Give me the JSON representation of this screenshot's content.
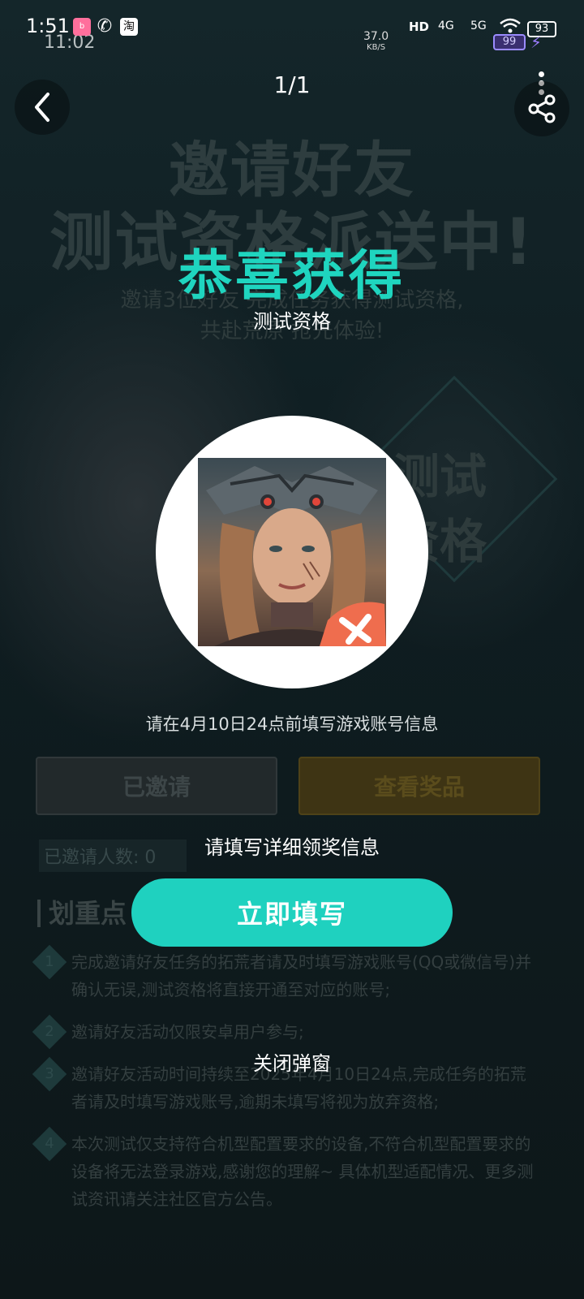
{
  "status_bar": {
    "time": "1:51",
    "time_secondary": "11:02",
    "speed_value": "37.0",
    "speed_unit": "KB/S",
    "hd": "HD",
    "net1": "4G",
    "net2": "5G",
    "battery": "93",
    "battery_secondary": "99"
  },
  "nav": {
    "page_indicator": "1/1"
  },
  "background": {
    "headline_line1": "邀请好友",
    "headline_line2": "测试资格派送中!",
    "sub_line1": "邀请3位好友 完成任务获得测试资格,",
    "sub_line2": "共赴荒原 抢先体验!",
    "badge_line1": "测试",
    "badge_line2": "资格",
    "invited_button": "已邀请",
    "prize_button": "查看奖品",
    "invited_count": "已邀请人数: 0",
    "section_title": "划重点",
    "rules": [
      "完成邀请好友任务的拓荒者请及时填写游戏账号(QQ或微信号)并确认无误,测试资格将直接开通至对应的账号;",
      "邀请好友活动仅限安卓用户参与;",
      "邀请好友活动时间持续至2025年4月10日24点,完成任务的拓荒者请及时填写游戏账号,逾期未填写将视为放弃资格;",
      "本次测试仅支持符合机型配置要求的设备,不符合机型配置要求的设备将无法登录游戏,感谢您的理解~ 具体机型适配情况、更多测试资讯请关注社区官方公告。"
    ]
  },
  "modal": {
    "title": "恭喜获得",
    "subtitle": "测试资格",
    "deadline": "请在4月10日24点前填写游戏账号信息",
    "prompt": "请填写详细领奖信息",
    "fill_button": "立即填写",
    "close_link": "关闭弹窗"
  },
  "colors": {
    "accent": "#1fd5bf",
    "button": "#1fd1bf"
  }
}
